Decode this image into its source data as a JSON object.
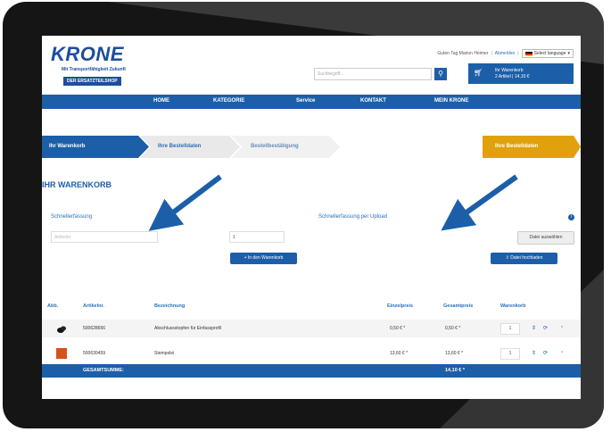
{
  "brand": {
    "name": "KRONE",
    "tagline": "Mit Transportfähigkeit Zukunft",
    "shop_label": "DER ERSATZTEILSHOP"
  },
  "header": {
    "greeting": "Guten Tag Marion Heimer",
    "logout": "Abmelden",
    "language": "Select language"
  },
  "search": {
    "placeholder": "Suchbegriff..."
  },
  "cart_summary": {
    "line1": "Ihr Warenkorb",
    "line2": "2 Artikel | 14,10 €"
  },
  "nav": [
    "HOME",
    "KATEGORIE",
    "Service",
    "KONTAKT",
    "MEIN KRONE"
  ],
  "steps": [
    "Ihr Warenkorb",
    "Ihre Bestelldaten",
    "Bestellbestätigung",
    "Ihre Bestelldaten"
  ],
  "page_title": "IHR WARENKORB",
  "quick_entry": {
    "label": "Schnellerfassung",
    "article_placeholder": "Artikelnr.",
    "qty_value": "1",
    "add_button": "In den Warenkorb"
  },
  "upload": {
    "label": "Schnellerfassung per Upload",
    "choose_button": "Datei auswählen",
    "upload_button": "Datei hochladen"
  },
  "table": {
    "headers": [
      "Abb.",
      "Artikelnr.",
      "Bezeichnung",
      "Einzelpreis",
      "Gesamtpreis",
      "Warenkorb"
    ],
    "rows": [
      {
        "article": "500628656",
        "description": "Abschlussstopfen für Einfassprofil",
        "unit_price": "0,50 € *",
        "total_price": "0,50 € *",
        "qty": "1"
      },
      {
        "article": "500630459",
        "description": "Stempelei",
        "unit_price": "13,60 € *",
        "total_price": "13,60 € *",
        "qty": "1"
      }
    ],
    "total_label": "GESAMTSUMME:",
    "total_value": "14,10 € *"
  },
  "colors": {
    "brand_blue": "#1c5fa8",
    "accent_gold": "#e0a10c",
    "frame": "#151515"
  }
}
